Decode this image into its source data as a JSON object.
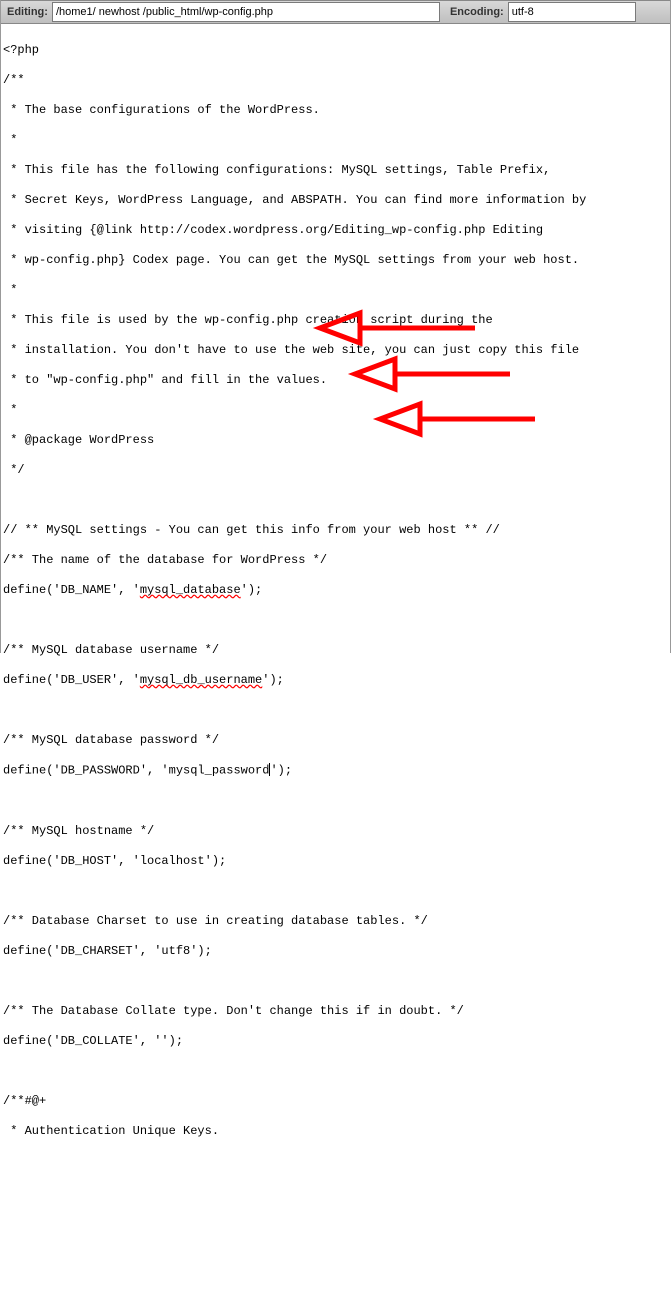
{
  "toolbar": {
    "editing_label": "Editing:",
    "path_value": "/home1/ newhost /public_html/wp-config.php",
    "encoding_label": "Encoding:",
    "encoding_value": "utf-8"
  },
  "code": {
    "l01": "<?php",
    "l02": "/**",
    "l03": " * The base configurations of the WordPress.",
    "l04": " *",
    "l05": " * This file has the following configurations: MySQL settings, Table Prefix,",
    "l06": " * Secret Keys, WordPress Language, and ABSPATH. You can find more information by",
    "l07": " * visiting {@link http://codex.wordpress.org/Editing_wp-config.php Editing",
    "l08": " * wp-config.php} Codex page. You can get the MySQL settings from your web host.",
    "l09": " *",
    "l10": " * This file is used by the wp-config.php creation script during the",
    "l11": " * installation. You don't have to use the web site, you can just copy this file",
    "l12": " * to \"wp-config.php\" and fill in the values.",
    "l13": " *",
    "l14": " * @package WordPress",
    "l15": " */",
    "l16": "",
    "l17": "// ** MySQL settings - You can get this info from your web host ** //",
    "l18": "/** The name of the database for WordPress */",
    "l19a": "define('DB_NAME', '",
    "l19b": "mysql_database",
    "l19c": "');",
    "l20": "",
    "l21": "/** MySQL database username */",
    "l22a": "define('DB_USER', '",
    "l22b": "mysql_db_username",
    "l22c": "');",
    "l23": "",
    "l24": "/** MySQL database password */",
    "l25a": "define('DB_PASSWORD', '",
    "l25b": "mysql_password",
    "l25c": "');",
    "l26": "",
    "l27": "/** MySQL hostname */",
    "l28": "define('DB_HOST', 'localhost');",
    "l29": "",
    "l30": "/** Database Charset to use in creating database tables. */",
    "l31": "define('DB_CHARSET', 'utf8');",
    "l32": "",
    "l33": "/** The Database Collate type. Don't change this if in doubt. */",
    "l34": "define('DB_COLLATE', '');",
    "l35": "",
    "l36": "/**#@+",
    "l37": " * Authentication Unique Keys."
  },
  "annotations": {
    "color": "#ff0000"
  }
}
